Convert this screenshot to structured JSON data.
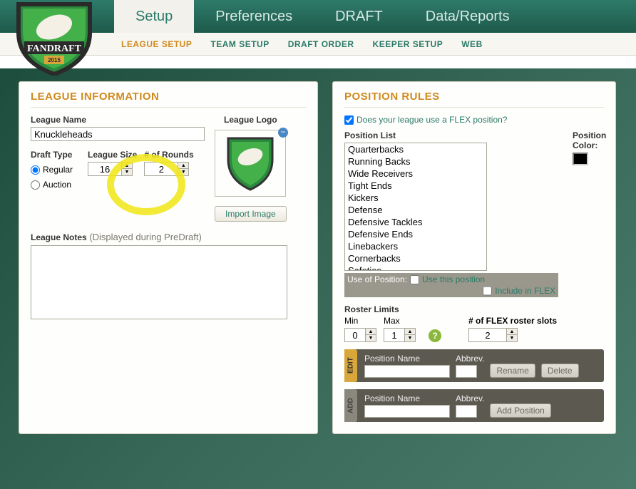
{
  "app": {
    "brand": "FANDRAFT",
    "year": "2015"
  },
  "tabs": {
    "setup": "Setup",
    "preferences": "Preferences",
    "draft": "DRAFT",
    "data": "Data/Reports"
  },
  "subnav": {
    "league_setup": "LEAGUE SETUP",
    "team_setup": "TEAM SETUP",
    "draft_order": "DRAFT ORDER",
    "keeper_setup": "KEEPER SETUP",
    "web": "WEB"
  },
  "league_info": {
    "title": "LEAGUE INFORMATION",
    "league_name_label": "League Name",
    "league_name": "Knuckleheads",
    "draft_type_label": "Draft Type",
    "draft_type_options": {
      "regular": "Regular",
      "auction": "Auction"
    },
    "draft_type_selected": "regular",
    "league_size_label": "League Size",
    "league_size": "16",
    "rounds_label": "# of Rounds",
    "rounds": "2",
    "logo_label": "League Logo",
    "import_btn": "Import Image",
    "notes_label": "League Notes",
    "notes_hint": "(Displayed during PreDraft)",
    "notes": ""
  },
  "position_rules": {
    "title": "POSITION RULES",
    "flex_question": "Does your league use a FLEX position?",
    "flex_checked": true,
    "list_label": "Position List",
    "color_label": "Position Color:",
    "positions": [
      "Quarterbacks",
      "Running Backs",
      "Wide Receivers",
      "Tight Ends",
      "Kickers",
      "Defense",
      "Defensive Tackles",
      "Defensive Ends",
      "Linebackers",
      "Cornerbacks",
      "Safeties"
    ],
    "use_of_position_label": "Use of Position:",
    "use_this_position": "Use this position",
    "include_in_flex": "Include in FLEX",
    "roster_limits_label": "Roster Limits",
    "min_label": "Min",
    "max_label": "Max",
    "min": "0",
    "max": "1",
    "flex_slots_label": "# of FLEX roster slots",
    "flex_slots": "2",
    "edit": {
      "tab": "EDIT",
      "pos_name_label": "Position Name",
      "abbrev_label": "Abbrev.",
      "rename_btn": "Rename",
      "delete_btn": "Delete"
    },
    "add": {
      "tab": "ADD",
      "pos_name_label": "Position Name",
      "abbrev_label": "Abbrev.",
      "add_btn": "Add Position"
    }
  }
}
